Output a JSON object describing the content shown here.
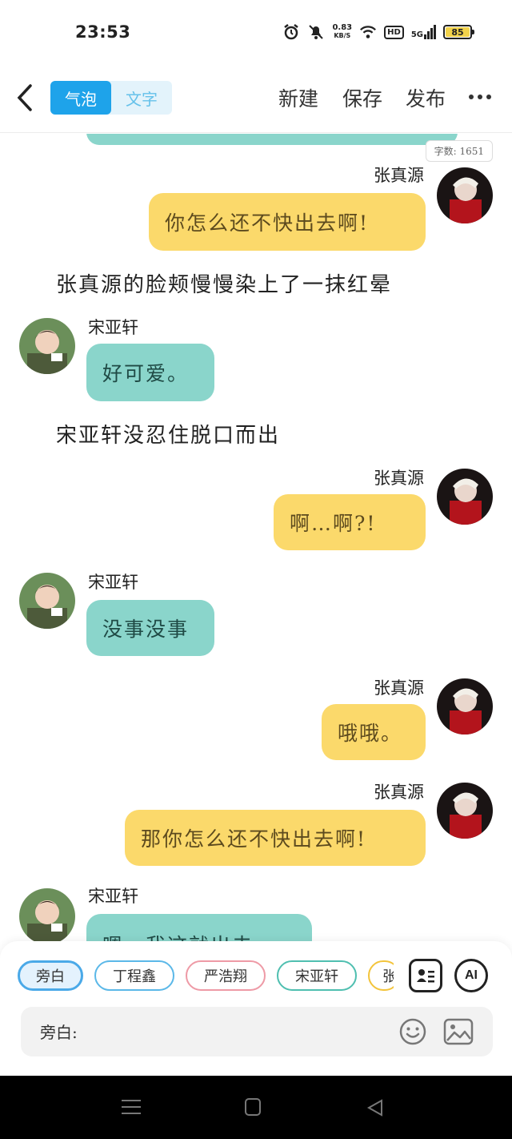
{
  "status_bar": {
    "time": "23:53",
    "net_speed_value": "0.83",
    "net_speed_unit": "KB/S",
    "hd": "HD",
    "network": "5G",
    "battery": "85"
  },
  "toolbar": {
    "mode_bubble": "气泡",
    "mode_text": "文字",
    "new_label": "新建",
    "save_label": "保存",
    "publish_label": "发布"
  },
  "chat": {
    "word_count": "字数: 1651",
    "messages": [
      {
        "speaker": "张真源",
        "text": "你怎么还不快出去啊!"
      },
      {
        "narration": "张真源的脸颊慢慢染上了一抹红晕"
      },
      {
        "speaker": "宋亚轩",
        "text": "好可爱。"
      },
      {
        "narration": "宋亚轩没忍住脱口而出"
      },
      {
        "speaker": "张真源",
        "text": "啊…啊?!"
      },
      {
        "speaker": "宋亚轩",
        "text": "没事没事"
      },
      {
        "speaker": "张真源",
        "text": "哦哦。"
      },
      {
        "speaker": "张真源",
        "text": "那你怎么还不快出去啊!"
      },
      {
        "speaker": "宋亚轩",
        "text": "嗯…我这就出去"
      }
    ]
  },
  "bottom": {
    "chips": [
      "旁白",
      "丁程鑫",
      "严浩翔",
      "宋亚轩",
      "张"
    ],
    "ai_label": "AI",
    "input_label": "旁白:"
  },
  "colors": {
    "accent": "#1ea3ea",
    "yellow_bubble": "#fbd96b",
    "teal_bubble": "#8ad5cb"
  }
}
